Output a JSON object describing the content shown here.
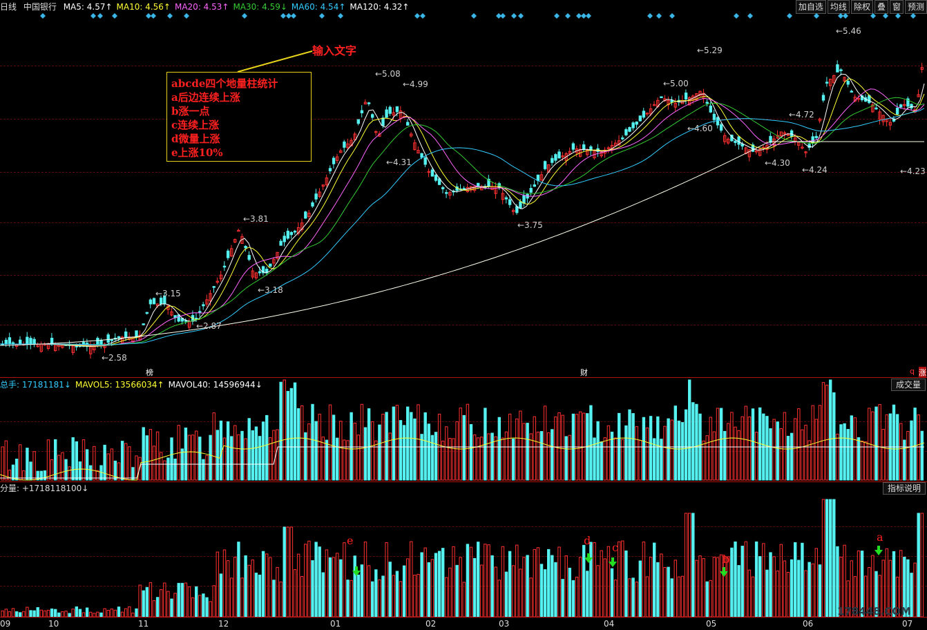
{
  "header": {
    "period": "日线",
    "stock": "中国银行",
    "ma": [
      {
        "label": "MA5: 4.57↑",
        "color": "#ffffff"
      },
      {
        "label": "MA10: 4.56↑",
        "color": "#ffff33"
      },
      {
        "label": "MA20: 4.53↑",
        "color": "#ff66ff"
      },
      {
        "label": "MA30: 4.59↓",
        "color": "#33cc33"
      },
      {
        "label": "MA60: 4.54↑",
        "color": "#33ccff"
      },
      {
        "label": "MA120: 4.32↑",
        "color": "#ffffff"
      }
    ]
  },
  "toolbar": [
    "加自选",
    "均线",
    "除权",
    "叠",
    "窗",
    "预测"
  ],
  "annotation": {
    "input_text": "输入文字",
    "note_lines": [
      "abcde四个地量柱统计",
      "a后边连续上涨",
      "b涨一点",
      "c连续上涨",
      "d微量上涨",
      "e上涨10%"
    ]
  },
  "price_labels": [
    "5.46",
    "5.29",
    "5.08",
    "5.00",
    "4.99",
    "4.72",
    "4.60",
    "4.31",
    "4.30",
    "4.24",
    "4.23",
    "3.81",
    "3.75",
    "3.18",
    "3.15",
    "2.87",
    "2.58"
  ],
  "event_markers": {
    "bang": "榜",
    "cai": "财",
    "q": "q",
    "zhang": "涨"
  },
  "volume_panel": {
    "header": [
      {
        "label": "总手: 17181181↓",
        "color": "#33ccff"
      },
      {
        "label": "MAVOL5: 13566034↑",
        "color": "#ffff33"
      },
      {
        "label": "MAVOL40: 14596944↓",
        "color": "#ffffff"
      }
    ],
    "button": "成交量"
  },
  "indicator_panel": {
    "header": "分量: +1718118100↓",
    "button": "指标说明",
    "markers": [
      "a",
      "b",
      "c",
      "d",
      "e"
    ]
  },
  "x_axis": [
    "09",
    "10",
    "11",
    "12",
    "01",
    "02",
    "03",
    "04",
    "05",
    "06",
    "07"
  ],
  "watermark": "178448.COM",
  "colors": {
    "up": "#ff3030",
    "down": "#55f0f0",
    "bg": "#000000",
    "grid": "#5a0d0d",
    "note_border": "#e6d21a"
  }
}
